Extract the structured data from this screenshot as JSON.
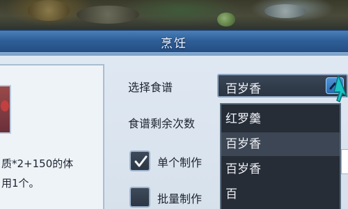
{
  "window": {
    "title": "烹饪"
  },
  "item": {
    "description_lines": [
      "质*2+150的体",
      "用1个。"
    ]
  },
  "recipe": {
    "label": "选择食谱",
    "selected": "百岁香",
    "remaining_label": "食谱剩余次数"
  },
  "options": {
    "single_label": "单个制作",
    "single_checked": true,
    "batch_label": "批量制作",
    "batch_checked": false
  },
  "dropdown": {
    "items": [
      "红罗羹",
      "百岁香",
      "百岁香",
      "百"
    ],
    "hovered_index": 1
  },
  "colors": {
    "title_bar": "#2f5f98",
    "panel": "#dfe8f2",
    "dropdown_bg": "#262d37",
    "accent_arrow": "#4f93d6"
  },
  "icons": {
    "select_arrow": "chevron-up-icon",
    "checkmark": "check-icon",
    "cursor": "pointer-cursor-icon"
  }
}
